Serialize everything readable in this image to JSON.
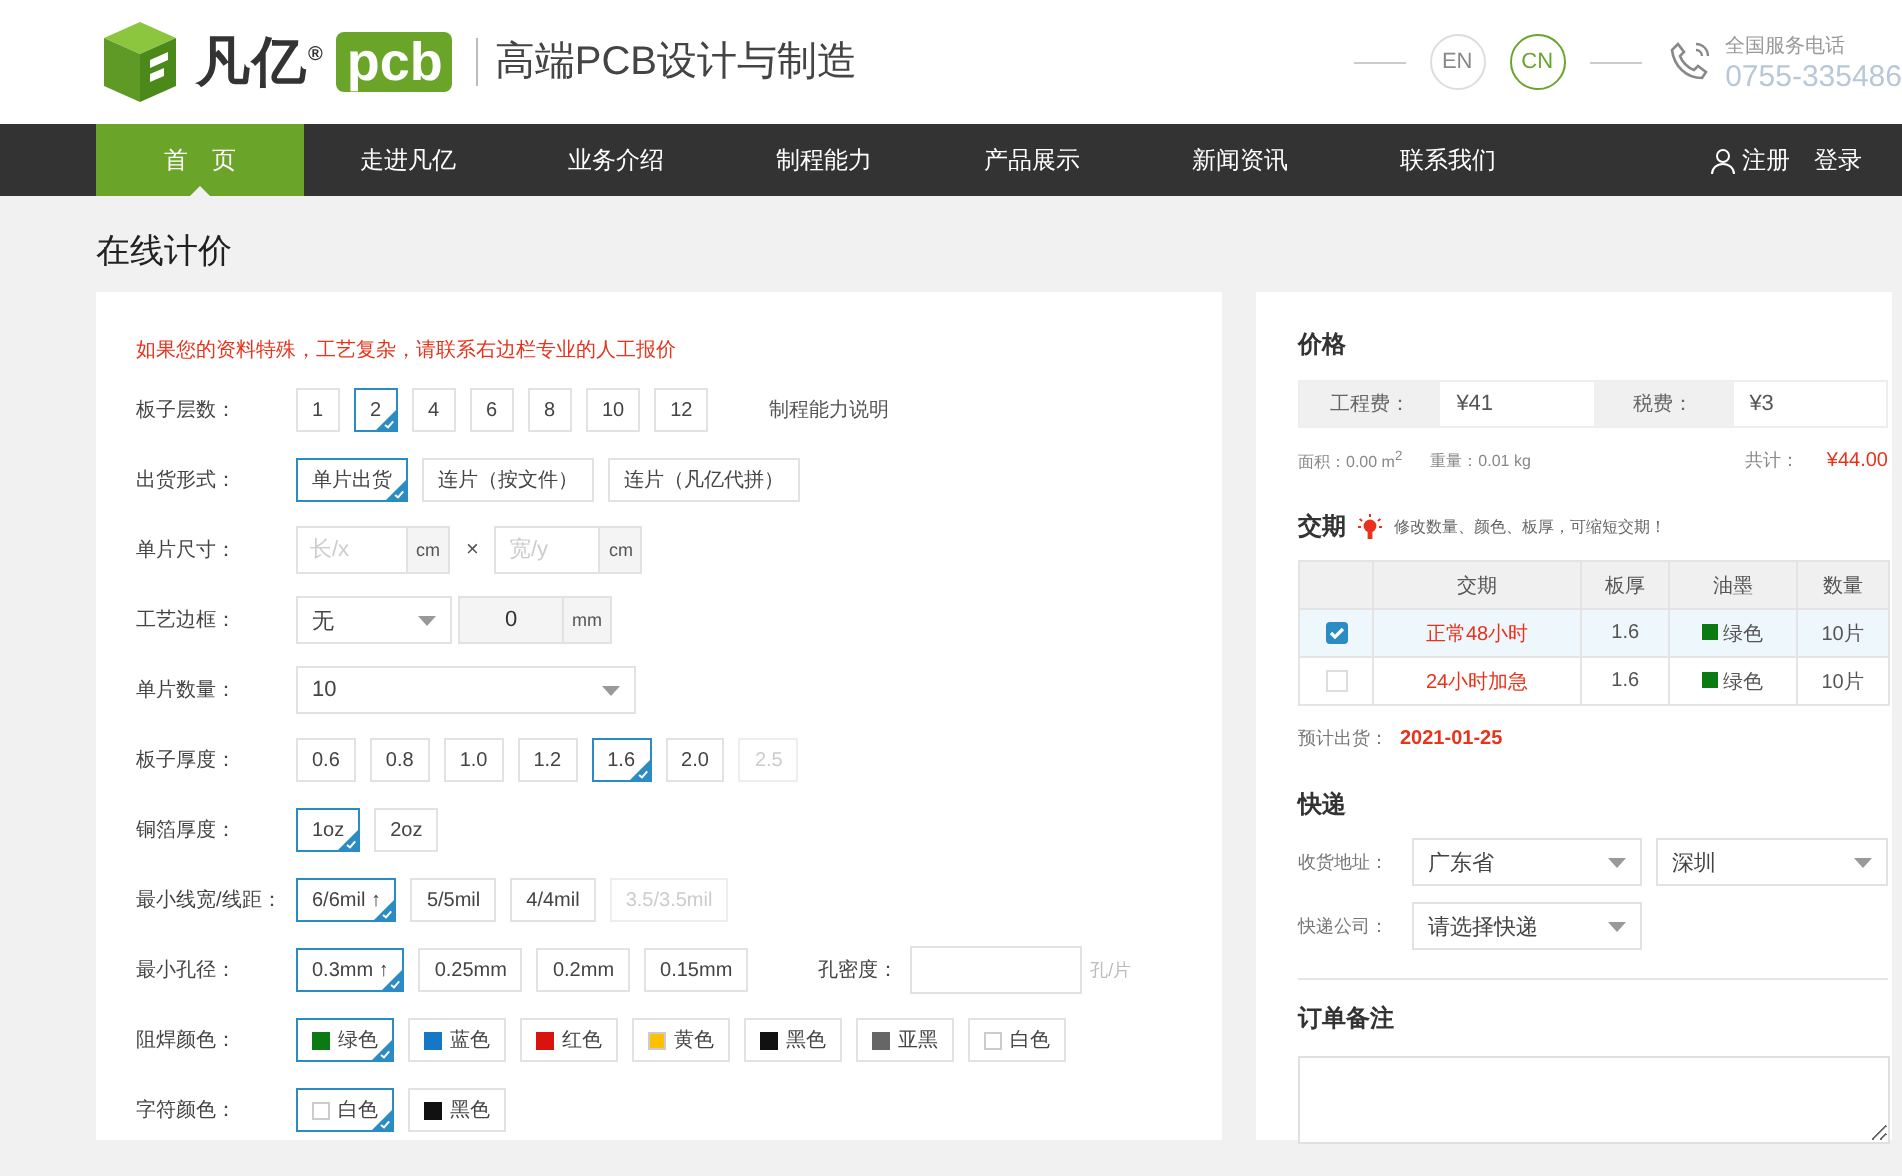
{
  "header": {
    "brand": "凡亿$^{®}$",
    "brand_mark": "pcb",
    "slogan": "高端PCB设计与制造",
    "languages": [
      {
        "label": "EN",
        "selected": false
      },
      {
        "label": "CN",
        "selected": true
      }
    ],
    "hotline_label": "全国服务电话",
    "hotline": "0755-335486"
  },
  "nav": {
    "items": [
      {
        "label": "首　页",
        "selected": true
      },
      {
        "label": "走进凡亿",
        "selected": false
      },
      {
        "label": "业务介绍",
        "selected": false
      },
      {
        "label": "制程能力",
        "selected": false
      },
      {
        "label": "产品展示",
        "selected": false
      },
      {
        "label": "新闻资讯",
        "selected": false
      },
      {
        "label": "联系我们",
        "selected": false
      }
    ],
    "register": "注册",
    "login": "登录"
  },
  "page_title": "在线计价",
  "form": {
    "notice": "如果您的资料特殊，工艺复杂，请联系右边栏专业的人工报价",
    "rows": [
      {
        "kind": "options",
        "label": "板子层数：",
        "options": [
          {
            "label": "1",
            "selected": false
          },
          {
            "label": "2",
            "selected": true
          },
          {
            "label": "4",
            "selected": false
          },
          {
            "label": "6",
            "selected": false
          },
          {
            "label": "8",
            "selected": false
          },
          {
            "label": "10",
            "selected": false
          },
          {
            "label": "12",
            "selected": false
          }
        ],
        "link": "制程能力说明"
      },
      {
        "kind": "options",
        "label": "出货形式：",
        "options": [
          {
            "label": "单片出货",
            "selected": true
          },
          {
            "label": "连片（按文件）",
            "selected": false
          },
          {
            "label": "连片（凡亿代拼）",
            "selected": false
          }
        ]
      },
      {
        "kind": "size",
        "label": "单片尺寸：",
        "length_placeholder": "长/x",
        "length_unit": "cm",
        "times": "×",
        "width_placeholder": "宽/y",
        "width_unit": "cm"
      },
      {
        "kind": "select_input",
        "label": "工艺边框：",
        "select": "无",
        "value": "0",
        "unit": "mm"
      },
      {
        "kind": "select",
        "label": "单片数量：",
        "value": "10"
      },
      {
        "kind": "options",
        "label": "板子厚度：",
        "options": [
          {
            "label": "0.6",
            "selected": false,
            "disabled": false
          },
          {
            "label": "0.8",
            "selected": false,
            "disabled": false
          },
          {
            "label": "1.0",
            "selected": false,
            "disabled": false
          },
          {
            "label": "1.2",
            "selected": false,
            "disabled": false
          },
          {
            "label": "1.6",
            "selected": true,
            "disabled": false
          },
          {
            "label": "2.0",
            "selected": false,
            "disabled": false
          },
          {
            "label": "2.5",
            "selected": false,
            "disabled": true
          }
        ]
      },
      {
        "kind": "options",
        "label": "铜箔厚度：",
        "options": [
          {
            "label": "1oz",
            "selected": true
          },
          {
            "label": "2oz",
            "selected": false
          }
        ]
      },
      {
        "kind": "options",
        "label": "最小线宽/线距：",
        "options": [
          {
            "label": "6/6mil ↑",
            "selected": true,
            "disabled": false
          },
          {
            "label": "5/5mil",
            "selected": false,
            "disabled": false
          },
          {
            "label": "4/4mil",
            "selected": false,
            "disabled": false
          },
          {
            "label": "3.5/3.5mil",
            "selected": false,
            "disabled": true
          }
        ]
      },
      {
        "kind": "options",
        "label": "最小孔径：",
        "options": [
          {
            "label": "0.3mm ↑",
            "selected": true
          },
          {
            "label": "0.25mm",
            "selected": false
          },
          {
            "label": "0.2mm",
            "selected": false
          },
          {
            "label": "0.15mm",
            "selected": false
          }
        ],
        "field": {
          "label": "孔密度：",
          "unit": "孔/片"
        }
      },
      {
        "kind": "options",
        "label": "阻焊颜色：",
        "options": [
          {
            "label": "绿色",
            "selected": true,
            "color": "#0b7a12"
          },
          {
            "label": "蓝色",
            "selected": false,
            "color": "#1677c9"
          },
          {
            "label": "红色",
            "selected": false,
            "color": "#d8140e"
          },
          {
            "label": "黄色",
            "selected": false,
            "color": "#ffc000"
          },
          {
            "label": "黑色",
            "selected": false,
            "color": "#111111"
          },
          {
            "label": "亚黑",
            "selected": false,
            "color": "#666666"
          },
          {
            "label": "白色",
            "selected": false,
            "color": "#ffffff"
          }
        ]
      },
      {
        "kind": "options",
        "label": "字符颜色：",
        "options": [
          {
            "label": "白色",
            "selected": true,
            "color": "#ffffff"
          },
          {
            "label": "黑色",
            "selected": false,
            "color": "#111111"
          }
        ]
      }
    ]
  },
  "price": {
    "title": "价格",
    "fees": [
      {
        "label": "工程费：",
        "value": "¥41"
      },
      {
        "label": "税费：",
        "value": "¥3"
      }
    ],
    "area": "面积：0.00 m$^{2}$",
    "weight": "重量：0.01 kg",
    "total_label": "共计：",
    "total": "¥44.00"
  },
  "delivery": {
    "title": "交期",
    "tip": "修改数量、颜色、板厚，可缩短交期！",
    "columns": [
      "交期",
      "板厚",
      "油墨",
      "数量"
    ],
    "rows": [
      {
        "selected": true,
        "term": "正常48小时",
        "thickness": "1.6",
        "ink": "绿色",
        "color": "#0b7a12",
        "quantity": "10片"
      },
      {
        "selected": false,
        "term": "24小时加急",
        "thickness": "1.6",
        "ink": "绿色",
        "color": "#0b7a12",
        "quantity": "10片"
      }
    ],
    "estimate_label": "预计出货：",
    "estimate": "2021-01-25"
  },
  "shipping": {
    "title": "快递",
    "address_label": "收货地址：",
    "province": "广东省",
    "city": "深圳",
    "company_label": "快递公司：",
    "company": "请选择快递"
  },
  "remarks": {
    "title": "订单备注"
  }
}
